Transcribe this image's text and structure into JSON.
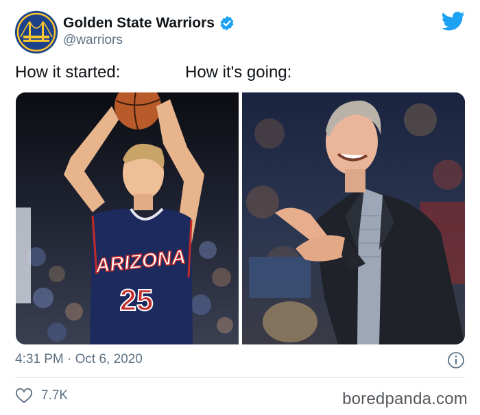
{
  "account": {
    "display_name": "Golden State Warriors",
    "handle": "@warriors",
    "verified": true
  },
  "tweet": {
    "caption_left": "How it started:",
    "caption_right": "How it's going:",
    "jersey_team": "ARIZONA",
    "jersey_number": "25",
    "timestamp": "4:31 PM · Oct 6, 2020",
    "like_count": "7.7K"
  },
  "watermark": "boredpanda.com",
  "icons": [
    "warriors-logo-icon",
    "verified-badge-icon",
    "twitter-bird-icon",
    "info-icon",
    "heart-icon"
  ],
  "colors": {
    "twitter_blue": "#1da1f2",
    "warriors_blue": "#1d428a",
    "warriors_gold": "#ffc72c",
    "secondary_text": "#5b7083"
  }
}
